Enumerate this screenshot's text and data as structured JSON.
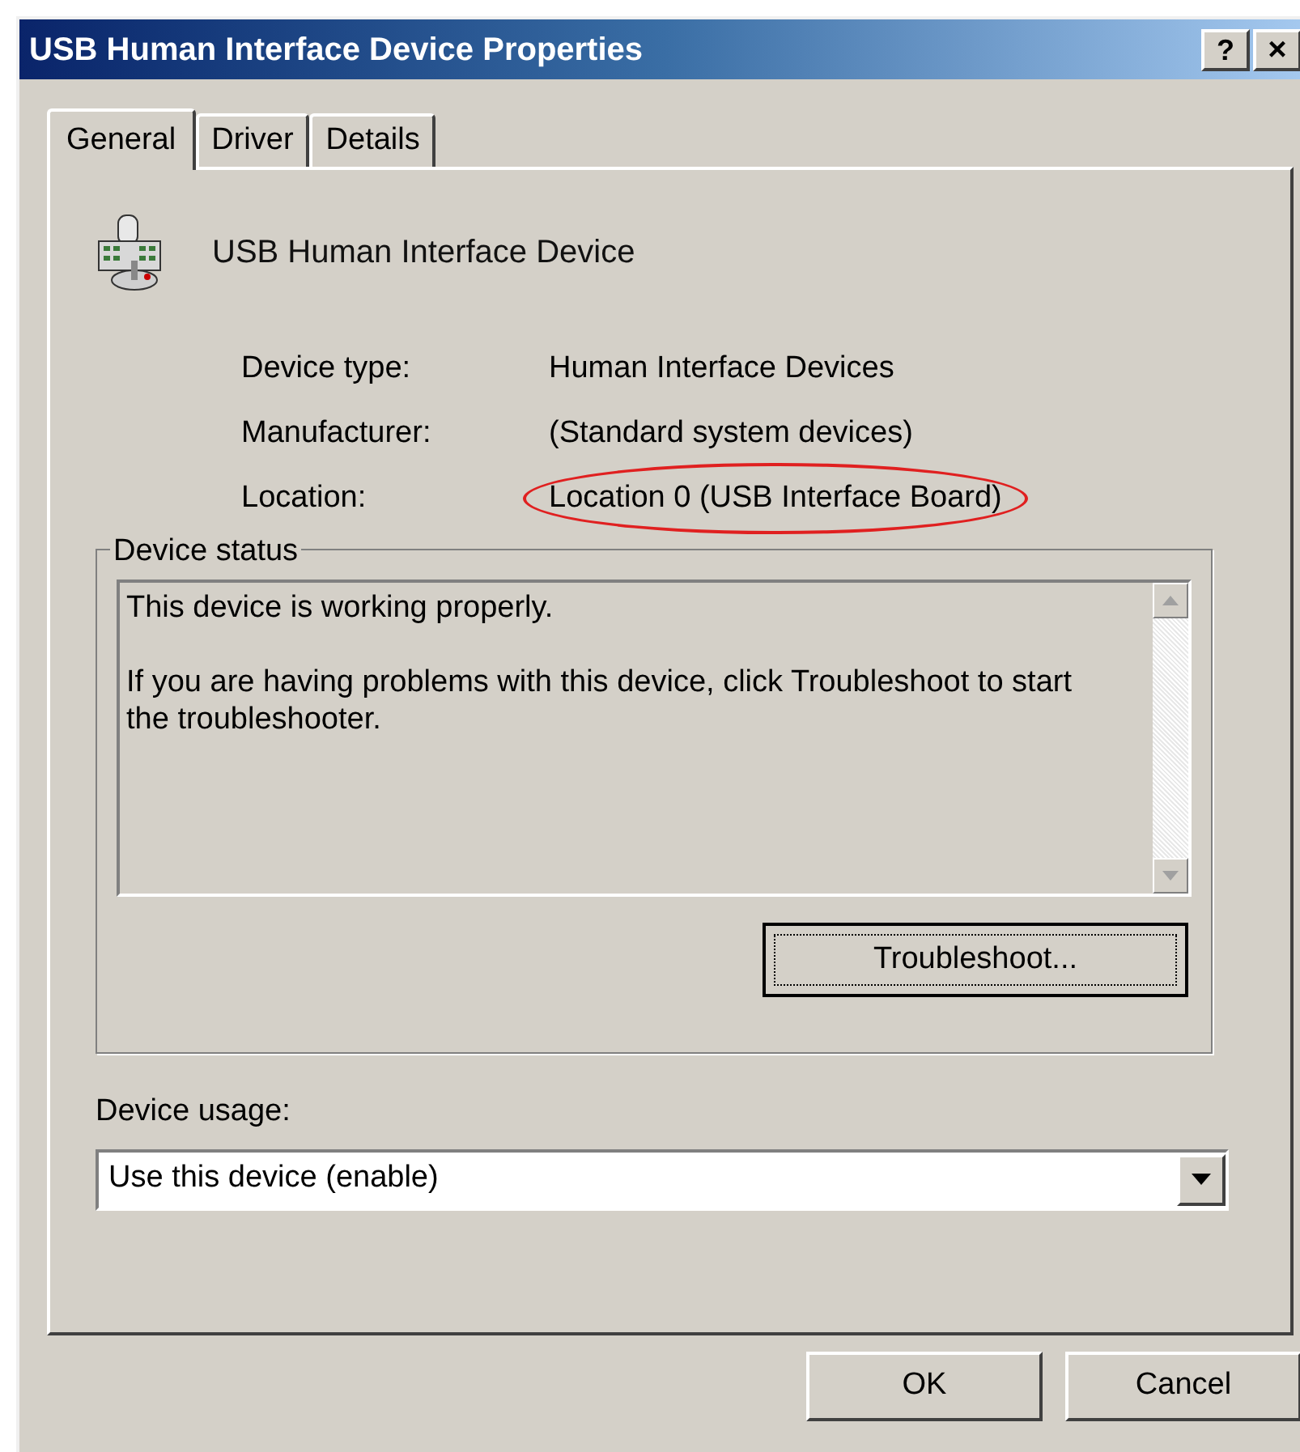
{
  "window": {
    "title": "USB Human Interface Device Properties",
    "help_button": "?",
    "close_button": "×"
  },
  "tabs": [
    {
      "label": "General",
      "selected": true
    },
    {
      "label": "Driver",
      "selected": false
    },
    {
      "label": "Details",
      "selected": false
    }
  ],
  "device": {
    "name": "USB Human Interface Device"
  },
  "properties": [
    {
      "label": "Device type:",
      "value": "Human Interface Devices",
      "highlighted": false
    },
    {
      "label": "Manufacturer:",
      "value": "(Standard system devices)",
      "highlighted": false
    },
    {
      "label": "Location:",
      "value": "Location 0 (USB Interface Board)",
      "highlighted": true
    }
  ],
  "device_status": {
    "title": "Device status",
    "lines": [
      "This device is working properly.",
      "If you are having problems with this device, click Troubleshoot to start the troubleshooter."
    ],
    "button": "Troubleshoot..."
  },
  "device_usage": {
    "label": "Device usage:",
    "value": "Use this device (enable)"
  },
  "buttons": [
    "OK",
    "Cancel"
  ]
}
